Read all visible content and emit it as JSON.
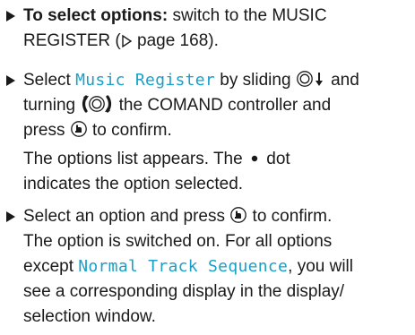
{
  "step1": {
    "label": "To select options:",
    "text_a": " switch to the MUSIC",
    "text_b": "REGISTER (",
    "page_ref_icon": "triangle-right-outline",
    "text_c": " page 168)."
  },
  "step2": {
    "text_a": "Select ",
    "menu_item": "Music Register",
    "text_b": " by sliding ",
    "slide_icon": "controller-slide-down",
    "text_c": " and",
    "text_d": "turning ",
    "turn_icon": "controller-turn",
    "text_e": " the COMAND controller and",
    "text_f": "press ",
    "press_icon": "controller-press",
    "text_g": " to confirm.",
    "result_a": "The options list appears. The ",
    "dot_icon": "bullet-dot",
    "result_b": " dot",
    "result_c": "indicates the option selected."
  },
  "step3": {
    "text_a": "Select an option and press ",
    "press_icon": "controller-press",
    "text_b": " to confirm.",
    "result_a": "The option is switched on. For all options",
    "result_b": "except ",
    "menu_item": "Normal Track Sequence",
    "result_c": ", you will",
    "result_d": "see a corresponding display in the display/",
    "result_e": "selection window."
  }
}
